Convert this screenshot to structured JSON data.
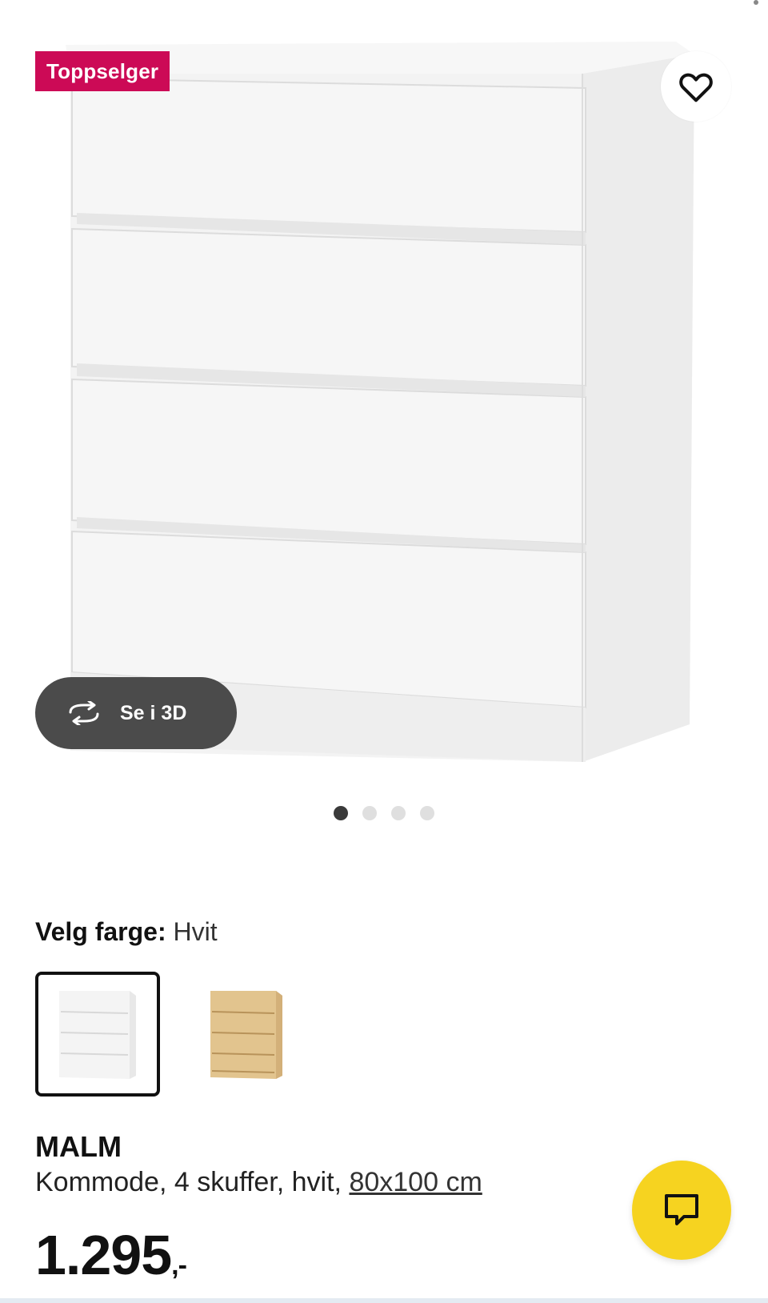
{
  "badge": {
    "text": "Toppselger"
  },
  "favorite": {
    "icon": "heart-icon"
  },
  "view3d": {
    "label": "Se i 3D",
    "icon": "rotate-3d-icon"
  },
  "carousel": {
    "total": 4,
    "active_index": 0
  },
  "color_picker": {
    "label": "Velg farge:",
    "value": "Hvit",
    "options": [
      {
        "name": "white-option",
        "color": "#f4f4f4",
        "selected": true
      },
      {
        "name": "oak-option",
        "color": "#e2c48e",
        "selected": false
      }
    ]
  },
  "product": {
    "name": "MALM",
    "description": "Kommode, 4 skuffer, hvit, ",
    "size": "80x100 cm",
    "price": "1.295",
    "price_suffix": ",-"
  },
  "chat": {
    "icon": "chat-icon"
  },
  "colors": {
    "badge": "#cc0a56",
    "chat": "#f6d320",
    "dark_pill": "#4b4b4b"
  }
}
